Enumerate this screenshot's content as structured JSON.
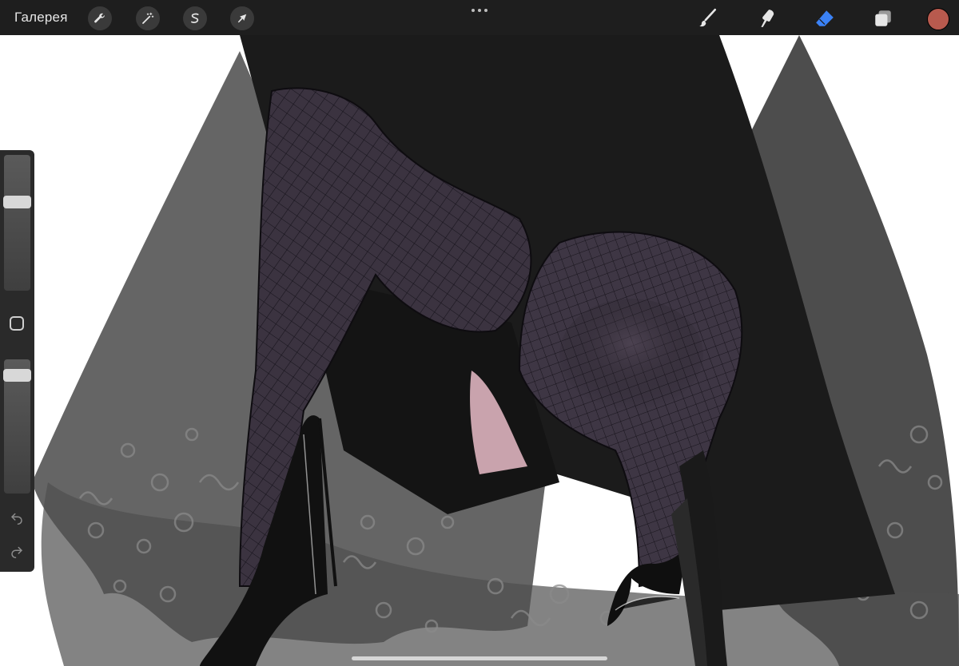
{
  "app": {
    "gallery_label": "Галерея"
  },
  "toolbar": {
    "left_tools": [
      {
        "icon": "wrench-icon",
        "name": "actions"
      },
      {
        "icon": "magic-wand-icon",
        "name": "adjustments"
      },
      {
        "icon": "selection-s-icon",
        "name": "selection"
      },
      {
        "icon": "arrow-cursor-icon",
        "name": "transform"
      }
    ],
    "right_tools": [
      {
        "icon": "brush-icon",
        "name": "brush"
      },
      {
        "icon": "smudge-icon",
        "name": "smudge"
      },
      {
        "icon": "eraser-icon",
        "name": "eraser",
        "active": true
      },
      {
        "icon": "layers-icon",
        "name": "layers"
      }
    ],
    "active_color": "#b85a4e",
    "accent_color": "#3b82f6"
  },
  "sidebar": {
    "brush_size_level": 0.67,
    "opacity_level": 0.92,
    "icons": [
      "undo-icon",
      "redo-icon"
    ]
  },
  "colors": {
    "toolbar_bg": "#1e1e1e",
    "canvas_bg": "#ffffff",
    "cloak": "#1a1a1a",
    "stocking": "#3d3441"
  }
}
